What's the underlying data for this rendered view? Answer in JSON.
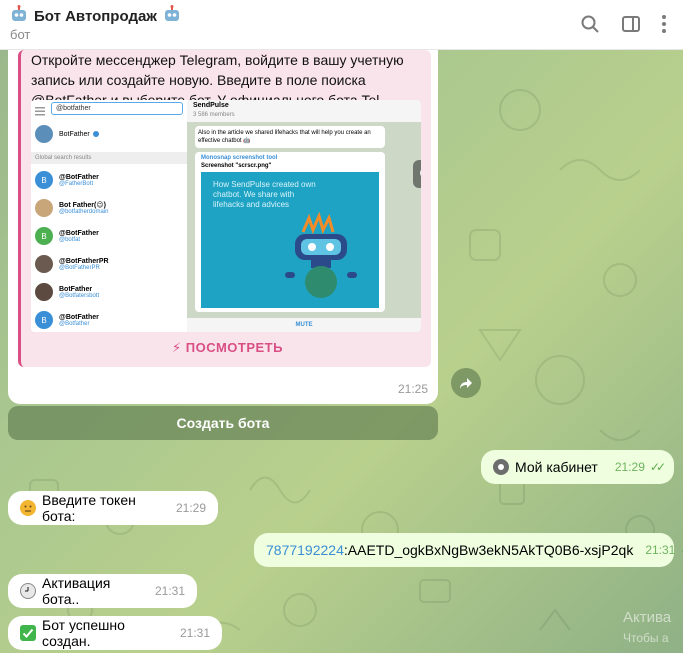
{
  "header": {
    "title": "Бот Автопродаж",
    "subtitle": "бот"
  },
  "card": {
    "text": "Откройте мессенджер Telegram, войдите в вашу учетную запись или создайте новую. Введите в поле поиска @BotFather и выберите бот. У официального бота Tel...",
    "link_label": "⚡ ПОСМОТРЕТЬ",
    "time": "21:25",
    "preview": {
      "search_value": "@botfather",
      "top_result": "BotFather",
      "global_label": "Global search results",
      "results": [
        {
          "name": "@BotFather",
          "handle": "@FatherBott",
          "avatar": "B",
          "color": "#3a8fd6"
        },
        {
          "name": "Bot Father(😉)",
          "handle": "@botfatherdomain",
          "avatar": "",
          "color": "#c9a57a"
        },
        {
          "name": "@BotFather",
          "handle": "@botfat",
          "avatar": "B",
          "color": "#4caf50"
        },
        {
          "name": "@BotFatherPR",
          "handle": "@BotFatherPR",
          "avatar": "",
          "color": "#6b5a4f"
        },
        {
          "name": "BotFather",
          "handle": "@Botfatersbott",
          "avatar": "",
          "color": "#5c4a40"
        },
        {
          "name": "@BotFather",
          "handle": "@Botfather",
          "avatar": "B",
          "color": "#3a8fd6"
        }
      ],
      "channel_name": "SendPulse",
      "channel_members": "3 586 members",
      "channel_text": "Also in the article we shared lifehacks that will help you create an effective chatbot 🤖",
      "link_title": "Monosnap screenshot tool",
      "link_sub": "Screenshot \"scrscr.png\"",
      "banner_text": "How SendPulse created own chatbot. We share with lifehacks and advices",
      "mute_label": "MUTE"
    }
  },
  "inline_button": "Создать бота",
  "messages": [
    {
      "dir": "out",
      "emoji": "⚙",
      "text": "Мой кабинет",
      "time": "21:29",
      "ticks": "✓✓"
    },
    {
      "dir": "in",
      "emoji": "🤔",
      "text": "Введите токен бота:",
      "time": "21:29"
    },
    {
      "dir": "out",
      "link": "7877192224",
      "text": ":AAETD_ogkBxNgBw3ekN5AkTQ0B6-xsjP2qk",
      "time": "21:31",
      "ticks": "✓✓"
    },
    {
      "dir": "in",
      "emoji": "🕘",
      "text": "Активация бота..",
      "time": "21:31"
    },
    {
      "dir": "in",
      "emoji": "✅",
      "text": "Бот успешно создан.",
      "time": "21:31"
    }
  ],
  "watermark": {
    "line1": "Актива",
    "line2": "Чтобы а"
  },
  "colors": {
    "accent": "#d94f83",
    "link": "#3a8fd6",
    "tick": "#5fae4d"
  }
}
